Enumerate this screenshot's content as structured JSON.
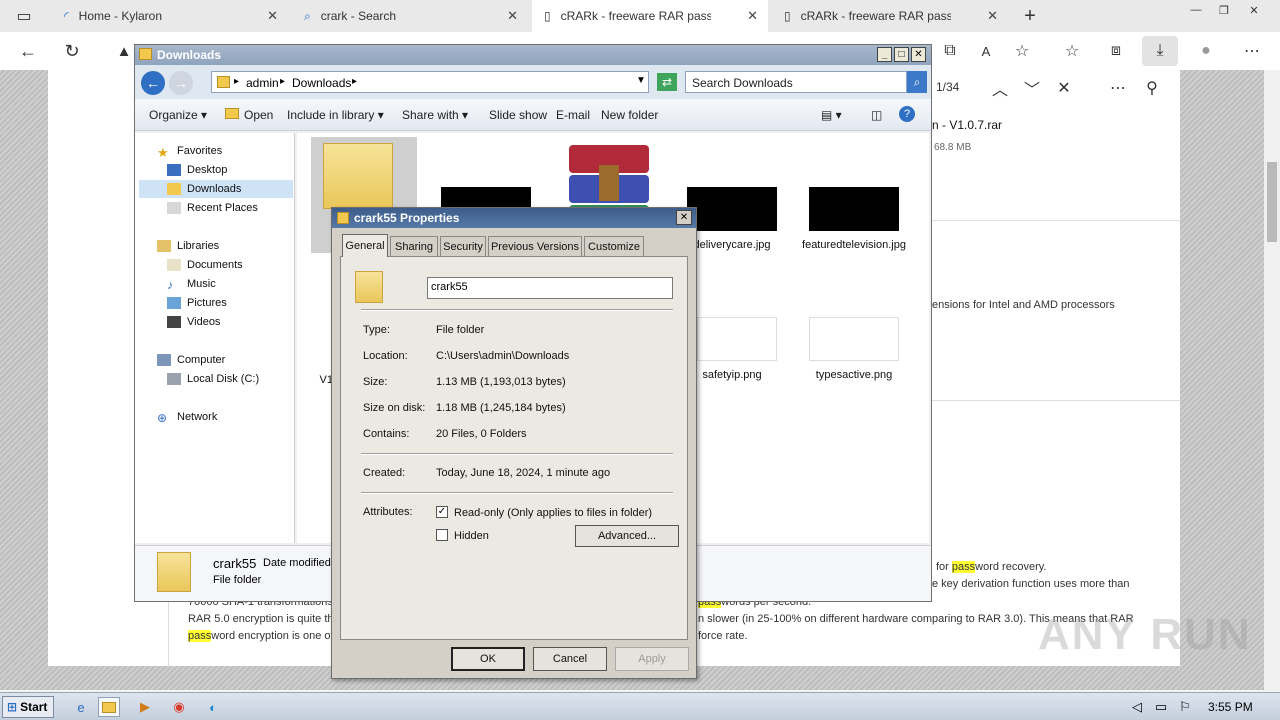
{
  "browser": {
    "tabs": [
      {
        "label": "Home - Kylaron",
        "active": false
      },
      {
        "label": "crark - Search",
        "active": false
      },
      {
        "label": "cRARk - freeware RAR password",
        "active": true
      },
      {
        "label": "cRARk - freeware RAR password",
        "active": false
      }
    ],
    "find": {
      "count": "1/34"
    },
    "icons": {
      "back": "back-arrow-icon",
      "refresh": "refresh-icon",
      "new_tab": "plus-icon",
      "download": "download-icon"
    }
  },
  "webpage": {
    "file_title": "n - V1.0.7.rar",
    "file_size": "68.8 MB",
    "feature_text": "ensions for Intel and AMD processors",
    "line1_pre": "for ",
    "line1_hl": "pass",
    "line1_post": "word recovery.",
    "line2": "e key derivation function uses more than",
    "line3_pre": "70000 SHA-1 transformations",
    "line3_hl": "pass",
    "line3_post": "words per second.",
    "line4_pre": "RAR 5.0 encryption is quite th",
    "line4_post": "n slower (in 25-100% on different hardware comparing to RAR 3.0). This means that RAR",
    "line5_hl": "pass",
    "line5_mid": "word encryption is one of",
    "line5_post": "force rate.",
    "watermark": "ANY RUN"
  },
  "explorer": {
    "title": "Downloads",
    "breadcrumb": [
      "admin",
      "Downloads"
    ],
    "search_placeholder": "Search Downloads",
    "commands": [
      "Organize",
      "Open",
      "Include in library",
      "Share with",
      "Slide show",
      "E-mail",
      "New folder"
    ],
    "nav": {
      "favorites_header": "Favorites",
      "favorites": [
        "Desktop",
        "Downloads",
        "Recent Places"
      ],
      "libraries_header": "Libraries",
      "libraries": [
        "Documents",
        "Music",
        "Pictures",
        "Videos"
      ],
      "computer_header": "Computer",
      "computer": [
        "Local Disk (C:)"
      ],
      "network": "Network"
    },
    "files": [
      {
        "name": "deliverycare.jpg"
      },
      {
        "name": "featuredtelevision.jpg"
      },
      {
        "name": "safetyip.png"
      },
      {
        "name": "typesactive.png"
      }
    ],
    "partial_labels": [
      "k",
      "V1"
    ],
    "details": {
      "name": "crark55",
      "date_label": "Date modified",
      "type": "File folder"
    }
  },
  "properties": {
    "title": "crark55 Properties",
    "tabs": [
      "General",
      "Sharing",
      "Security",
      "Previous Versions",
      "Customize"
    ],
    "name_value": "crark55",
    "rows": [
      {
        "label": "Type:",
        "value": "File folder"
      },
      {
        "label": "Location:",
        "value": "C:\\Users\\admin\\Downloads"
      },
      {
        "label": "Size:",
        "value": "1.13 MB (1,193,013 bytes)"
      },
      {
        "label": "Size on disk:",
        "value": "1.18 MB (1,245,184 bytes)"
      },
      {
        "label": "Contains:",
        "value": "20 Files, 0 Folders"
      }
    ],
    "created_label": "Created:",
    "created_value": "Today, June 18, 2024, 1 minute ago",
    "attributes_label": "Attributes:",
    "readonly_label": "Read-only (Only applies to files in folder)",
    "readonly_checked": true,
    "hidden_label": "Hidden",
    "hidden_checked": false,
    "advanced_label": "Advanced...",
    "ok_label": "OK",
    "cancel_label": "Cancel",
    "apply_label": "Apply"
  },
  "taskbar": {
    "start_label": "Start",
    "clock": "3:55 PM"
  }
}
